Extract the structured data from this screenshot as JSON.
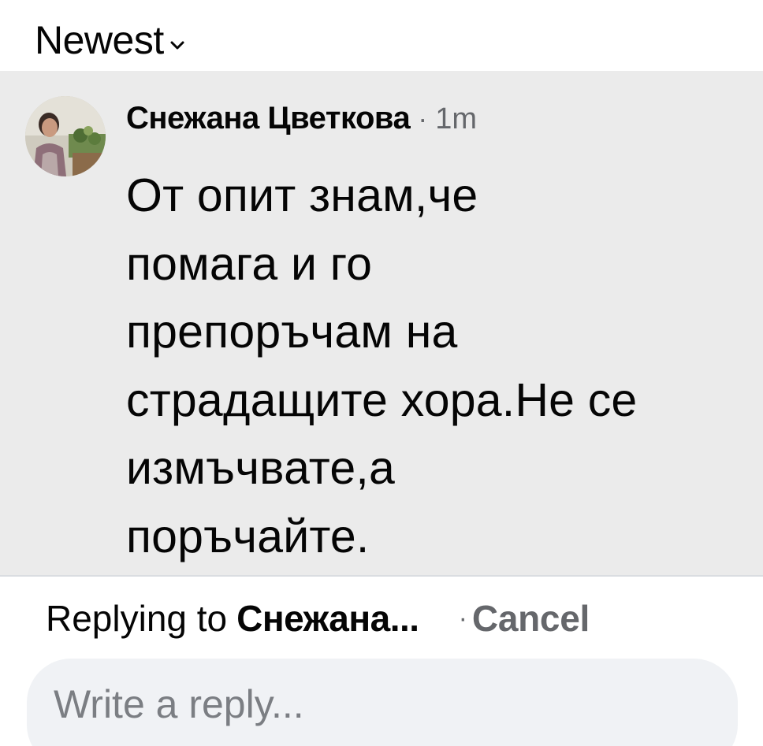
{
  "sort": {
    "label": "Newest"
  },
  "comment": {
    "author": "Снежана Цветкова",
    "separator": "·",
    "time": "1m",
    "text_lines": [
      "От опит знам,че",
      "помага и го",
      "препоръчам на",
      "страдащите хора.Не се",
      "измъчвате,а",
      "поръчайте."
    ]
  },
  "reply": {
    "prefix": "Replying to",
    "target": "Снежана...",
    "separator": "·",
    "cancel": "Cancel"
  },
  "input": {
    "placeholder": "Write a reply..."
  },
  "colors": {
    "comment_bg": "#ebebeb",
    "secondary_text": "#65676b",
    "input_bg": "#f0f2f5",
    "primary_text": "#050505"
  }
}
